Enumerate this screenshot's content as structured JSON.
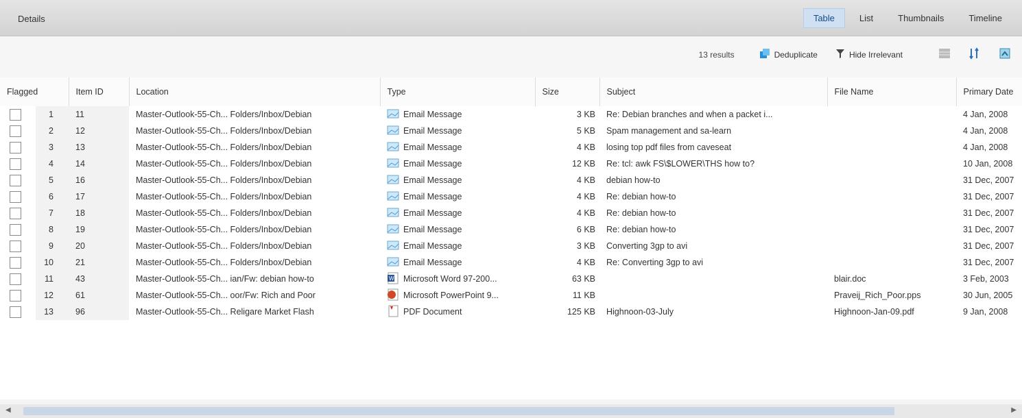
{
  "header": {
    "title": "Details"
  },
  "view_tabs": [
    {
      "label": "Table",
      "active": true
    },
    {
      "label": "List",
      "active": false
    },
    {
      "label": "Thumbnails",
      "active": false
    },
    {
      "label": "Timeline",
      "active": false
    }
  ],
  "toolbar": {
    "results_text": "13 results",
    "deduplicate_label": "Deduplicate",
    "hide_irrelevant_label": "Hide Irrelevant"
  },
  "columns": [
    "Flagged",
    "Item ID",
    "Location",
    "Type",
    "Size",
    "Subject",
    "File Name",
    "Primary Date"
  ],
  "rows": [
    {
      "num": "1",
      "id": "11",
      "location": "Master-Outlook-55-Ch... Folders/Inbox/Debian",
      "type": "Email Message",
      "icon": "email-icon",
      "size": "3 KB",
      "subject": "Re: Debian branches and when a packet i...",
      "file_name": "",
      "date": "4 Jan, 2008"
    },
    {
      "num": "2",
      "id": "12",
      "location": "Master-Outlook-55-Ch... Folders/Inbox/Debian",
      "type": "Email Message",
      "icon": "email-icon",
      "size": "5 KB",
      "subject": "Spam management and sa-learn",
      "file_name": "",
      "date": "4 Jan, 2008"
    },
    {
      "num": "3",
      "id": "13",
      "location": "Master-Outlook-55-Ch... Folders/Inbox/Debian",
      "type": "Email Message",
      "icon": "email-icon",
      "size": "4 KB",
      "subject": "losing top pdf files from caveseat",
      "file_name": "",
      "date": "4 Jan, 2008"
    },
    {
      "num": "4",
      "id": "14",
      "location": "Master-Outlook-55-Ch... Folders/Inbox/Debian",
      "type": "Email Message",
      "icon": "email-icon",
      "size": "12 KB",
      "subject": "Re: tcl: awk FS\\$LOWER\\THS how to?",
      "file_name": "",
      "date": "10 Jan, 2008"
    },
    {
      "num": "5",
      "id": "16",
      "location": "Master-Outlook-55-Ch... Folders/Inbox/Debian",
      "type": "Email Message",
      "icon": "email-icon",
      "size": "4 KB",
      "subject": "debian how-to",
      "file_name": "",
      "date": "31 Dec, 2007"
    },
    {
      "num": "6",
      "id": "17",
      "location": "Master-Outlook-55-Ch... Folders/Inbox/Debian",
      "type": "Email Message",
      "icon": "email-icon",
      "size": "4 KB",
      "subject": "Re: debian how-to",
      "file_name": "",
      "date": "31 Dec, 2007"
    },
    {
      "num": "7",
      "id": "18",
      "location": "Master-Outlook-55-Ch... Folders/Inbox/Debian",
      "type": "Email Message",
      "icon": "email-icon",
      "size": "4 KB",
      "subject": "Re: debian how-to",
      "file_name": "",
      "date": "31 Dec, 2007"
    },
    {
      "num": "8",
      "id": "19",
      "location": "Master-Outlook-55-Ch... Folders/Inbox/Debian",
      "type": "Email Message",
      "icon": "email-icon",
      "size": "6 KB",
      "subject": "Re: debian how-to",
      "file_name": "",
      "date": "31 Dec, 2007"
    },
    {
      "num": "9",
      "id": "20",
      "location": "Master-Outlook-55-Ch... Folders/Inbox/Debian",
      "type": "Email Message",
      "icon": "email-icon",
      "size": "3 KB",
      "subject": "Converting 3gp to avi",
      "file_name": "",
      "date": "31 Dec, 2007"
    },
    {
      "num": "10",
      "id": "21",
      "location": "Master-Outlook-55-Ch... Folders/Inbox/Debian",
      "type": "Email Message",
      "icon": "email-icon",
      "size": "4 KB",
      "subject": "Re: Converting 3gp to avi",
      "file_name": "",
      "date": "31 Dec, 2007"
    },
    {
      "num": "11",
      "id": "43",
      "location": "Master-Outlook-55-Ch... ian/Fw: debian how-to",
      "type": "Microsoft Word 97-200...",
      "icon": "word-doc-icon",
      "size": "63 KB",
      "subject": "",
      "file_name": "blair.doc",
      "date": "3 Feb, 2003"
    },
    {
      "num": "12",
      "id": "61",
      "location": "Master-Outlook-55-Ch... oor/Fw: Rich and Poor",
      "type": "Microsoft PowerPoint 9...",
      "icon": "powerpoint-icon",
      "size": "11 KB",
      "subject": "",
      "file_name": "Praveij_Rich_Poor.pps",
      "date": "30 Jun, 2005"
    },
    {
      "num": "13",
      "id": "96",
      "location": "Master-Outlook-55-Ch... Religare Market Flash",
      "type": "PDF Document",
      "icon": "pdf-icon",
      "size": "125 KB",
      "subject": "Highnoon-03-July",
      "file_name": "Highnoon-Jan-09.pdf",
      "date": "9 Jan, 2008"
    }
  ]
}
